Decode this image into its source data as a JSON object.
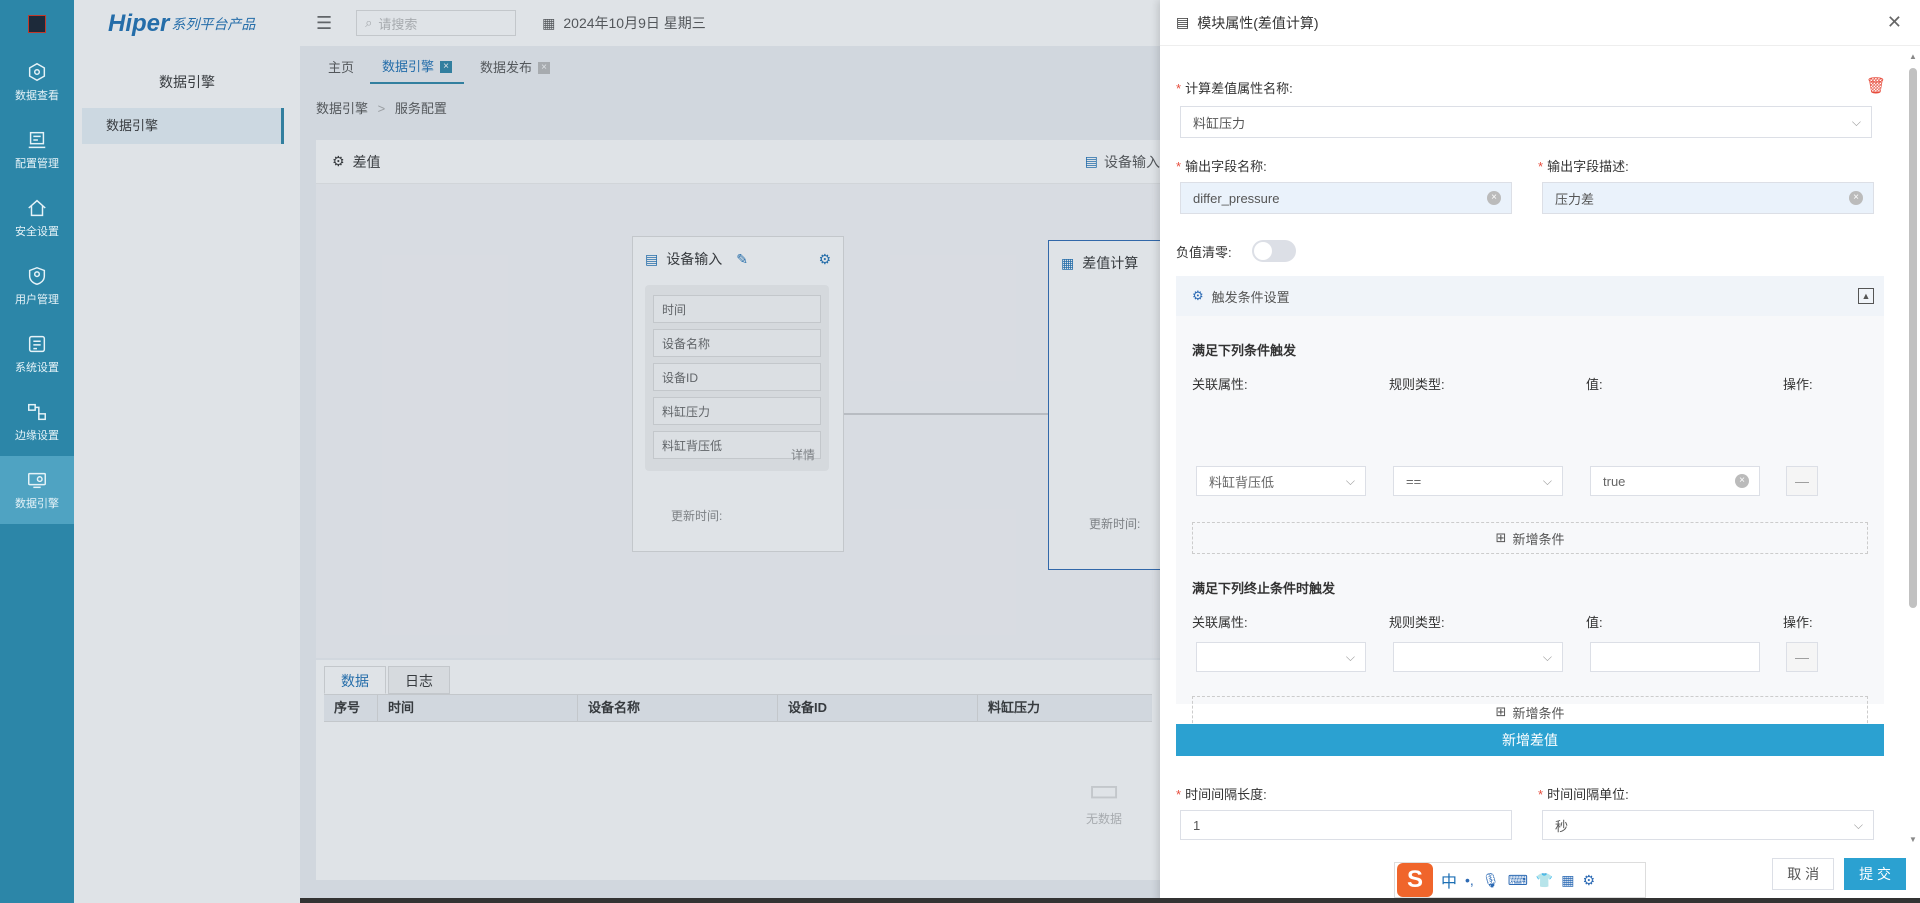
{
  "rail": {
    "items": [
      {
        "label": "数据查看",
        "icon": "cube-icon"
      },
      {
        "label": "配置管理",
        "icon": "config-icon"
      },
      {
        "label": "安全设置",
        "icon": "security-icon"
      },
      {
        "label": "用户管理",
        "icon": "user-icon"
      },
      {
        "label": "系统设置",
        "icon": "system-icon"
      },
      {
        "label": "边缘设置",
        "icon": "edge-icon"
      },
      {
        "label": "数据引擎",
        "icon": "engine-icon"
      }
    ]
  },
  "brand": {
    "name": "Hiper",
    "suffix": "系列平台产品"
  },
  "sidebar": {
    "title": "数据引擎",
    "item": "数据引擎"
  },
  "header": {
    "search_placeholder": "请搜索",
    "date": "2024年10月9日 星期三"
  },
  "tabs": [
    {
      "label": "主页"
    },
    {
      "label": "数据引擎"
    },
    {
      "label": "数据发布"
    }
  ],
  "breadcrumb": {
    "part1": "数据引擎",
    "sep": ">",
    "part2": "服务配置"
  },
  "canvas": {
    "title": "差值",
    "device_input_btn": "设备输入",
    "node1": {
      "title": "设备输入",
      "fields": [
        "时间",
        "设备名称",
        "设备ID",
        "料缸压力",
        "料缸背压低"
      ],
      "detail": "详情",
      "updated": "更新时间:"
    },
    "node2": {
      "title": "差值计算",
      "updated": "更新时间:"
    }
  },
  "data_panel": {
    "tabs": [
      "数据",
      "日志"
    ],
    "columns": [
      "序号",
      "时间",
      "设备名称",
      "设备ID",
      "料缸压力"
    ],
    "empty": "无数据"
  },
  "drawer": {
    "title": "模块属性(差值计算)",
    "calc_label": "计算差值属性名称:",
    "calc_value": "料缸压力",
    "out_name_label": "输出字段名称:",
    "out_name_value": "differ_pressure",
    "out_desc_label": "输出字段描述:",
    "out_desc_value": "压力差",
    "neg_zero_label": "负值清零:",
    "trigger": {
      "title": "触发条件设置",
      "start_title": "满足下列条件触发",
      "stop_title": "满足下列终止条件时触发",
      "col_attr": "关联属性:",
      "col_rule": "规则类型:",
      "col_value": "值:",
      "col_op": "操作:",
      "start_row": {
        "attr": "料缸背压低",
        "rule": "==",
        "value": "true"
      },
      "add_cond": "新增条件"
    },
    "add_diff": "新增差值",
    "interval_len_label": "时间间隔长度:",
    "interval_len_value": "1",
    "interval_unit_label": "时间间隔单位:",
    "interval_unit_value": "秒",
    "cancel": "取 消",
    "submit": "提 交"
  },
  "ime": {
    "lang": "中"
  }
}
